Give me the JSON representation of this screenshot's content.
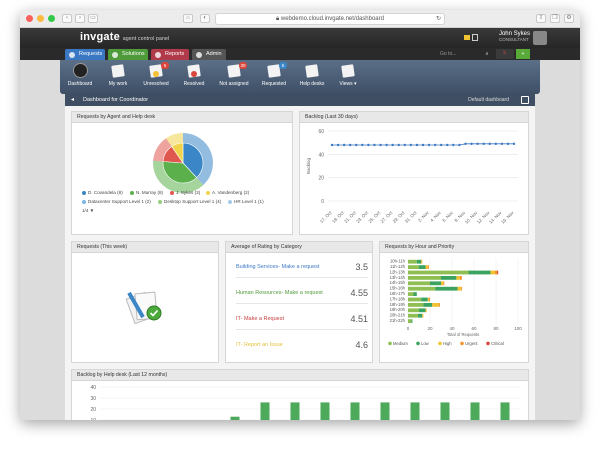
{
  "browser": {
    "url": "webdemo.cloud.invgate.net/dashboard"
  },
  "app": {
    "logo": "invgate",
    "logo_sub": "agent control panel",
    "user_name": "John Sykes",
    "user_sub": "CONSULTANT",
    "goto_placeholder": "Go to..."
  },
  "tabs": [
    {
      "label": "Requests",
      "color": "#3b78c4"
    },
    {
      "label": "Solutions",
      "color": "#4f9a3b"
    },
    {
      "label": "Reports",
      "color": "#b03a4a"
    },
    {
      "label": "Admin",
      "color": "#555555"
    }
  ],
  "toolbar": [
    {
      "label": "Dashboard",
      "badge": ""
    },
    {
      "label": "My work",
      "badge": ""
    },
    {
      "label": "Unresolved",
      "badge": "5"
    },
    {
      "label": "Resolved",
      "badge": ""
    },
    {
      "label": "Not assigned",
      "badge": "30"
    },
    {
      "label": "Requested",
      "badge": "5"
    },
    {
      "label": "Help desks",
      "badge": ""
    },
    {
      "label": "Views ▾",
      "badge": ""
    }
  ],
  "breadcrumb": {
    "title": "Dashboard for Coordinator",
    "right": "Default dashboard"
  },
  "panels": {
    "agent_helpdesk": {
      "title": "Requests by Agent and Help desk",
      "legend": [
        {
          "label": "D. Covandela (8)",
          "color": "#3b86c6"
        },
        {
          "label": "N. Murray (8)",
          "color": "#5bb04c"
        },
        {
          "label": "J. Sykes (3)",
          "color": "#e0574f"
        },
        {
          "label": "A. Vandenberg (2)",
          "color": "#f1d44a"
        },
        {
          "label": "Datacenter Support Level 1 (2)",
          "color": "#7cb7e3"
        },
        {
          "label": "Desktop Support Level 1 (4)",
          "color": "#93cf7c"
        },
        {
          "label": "HR Level 1 (1)",
          "color": "#a7c8e8"
        }
      ],
      "pager": "1/4 ▼"
    },
    "backlog30": {
      "title": "Backlog (Last 30 days)"
    },
    "this_week": {
      "title": "Requests (This week)"
    },
    "avg_rating": {
      "title": "Average of Rating by Category",
      "rows": [
        {
          "label": "Building Services- Make a request",
          "value": "3.5",
          "color": "#3b78c4"
        },
        {
          "label": "Human Resources- Make a request",
          "value": "4.55",
          "color": "#4f9a3b"
        },
        {
          "label": "IT- Make a Request",
          "value": "4.51",
          "color": "#c43b3b"
        },
        {
          "label": "IT- Report an Issue",
          "value": "4.6",
          "color": "#e3c23b"
        }
      ]
    },
    "hour_priority": {
      "title": "Requests by Hour and Priority",
      "legend": [
        {
          "label": "Medium",
          "color": "#8fbf52"
        },
        {
          "label": "Low",
          "color": "#3aa360"
        },
        {
          "label": "High",
          "color": "#f1c232"
        },
        {
          "label": "Urgent",
          "color": "#f0962e"
        },
        {
          "label": "Critical",
          "color": "#d9463c"
        }
      ]
    },
    "backlog12": {
      "title": "Backlog by Help desk (Last 12 months)"
    }
  },
  "chart_data": [
    {
      "type": "pie",
      "categories": [
        "D. Covandela",
        "N. Murray",
        "J. Sykes",
        "A. Vandenberg"
      ],
      "values": [
        8,
        8,
        3,
        2
      ]
    },
    {
      "type": "line",
      "ylabel": "Backlog",
      "ylim": [
        0,
        60
      ],
      "yticks": [
        0,
        20,
        40,
        60
      ],
      "x": [
        "17. Oct",
        "19. Oct",
        "21. Oct",
        "23. Oct",
        "25. Oct",
        "27. Oct",
        "29. Oct",
        "31. Oct",
        "2. Nov",
        "4. Nov",
        "6. Nov",
        "8. Nov",
        "10. Nov",
        "12. Nov",
        "14. Nov",
        "16. Nov"
      ],
      "series": [
        {
          "values": [
            48,
            48,
            48,
            48,
            48,
            48,
            48,
            48,
            48,
            48,
            48,
            48,
            48,
            48,
            48,
            48,
            48,
            48,
            48,
            48,
            48,
            48,
            49,
            49,
            49,
            49,
            49,
            49,
            49,
            49,
            49
          ]
        }
      ]
    },
    {
      "type": "bar",
      "orientation": "horizontal",
      "stacked": true,
      "xlabel": "Total of Requests",
      "xlim": [
        0,
        100
      ],
      "xticks": [
        0,
        20,
        40,
        60,
        80,
        100
      ],
      "categories": [
        "10h-11h",
        "11h-12h",
        "12h-13h",
        "13h-14h",
        "14h-15h",
        "15h-16h",
        "16h-17h",
        "17h-18h",
        "18h-19h",
        "19h-20h",
        "20h-21h",
        "21h-22h"
      ],
      "series": [
        {
          "name": "Medium",
          "values": [
            8,
            10,
            55,
            30,
            20,
            25,
            5,
            12,
            14,
            10,
            9,
            3
          ]
        },
        {
          "name": "Low",
          "values": [
            4,
            6,
            20,
            14,
            10,
            20,
            3,
            6,
            8,
            6,
            4,
            1
          ]
        },
        {
          "name": "High",
          "values": [
            1,
            2,
            4,
            3,
            2,
            3,
            0,
            1,
            6,
            1,
            1,
            0
          ]
        },
        {
          "name": "Urgent",
          "values": [
            0,
            1,
            2,
            2,
            1,
            1,
            0,
            1,
            1,
            0,
            0,
            0
          ]
        },
        {
          "name": "Critical",
          "values": [
            0,
            0,
            1,
            0,
            0,
            0,
            0,
            0,
            0,
            0,
            0,
            0
          ]
        }
      ]
    },
    {
      "type": "bar",
      "ylim": [
        0,
        40
      ],
      "yticks": [
        10,
        20,
        30,
        40
      ],
      "values": [
        0,
        0,
        3,
        5,
        13,
        26,
        26,
        26,
        26,
        26,
        26,
        26,
        26,
        26
      ]
    }
  ]
}
